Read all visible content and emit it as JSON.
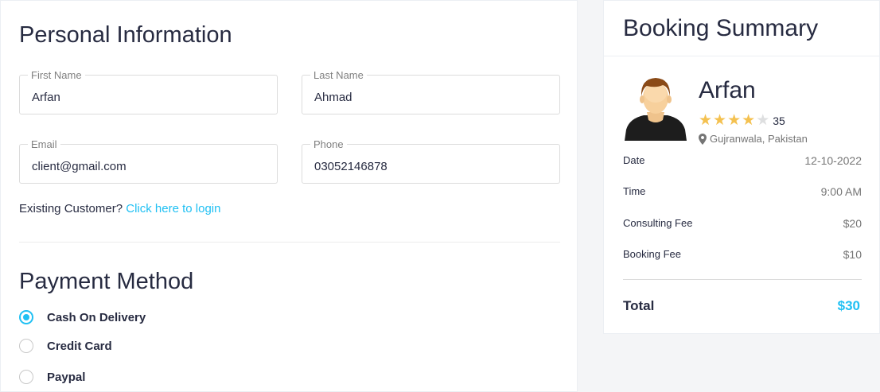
{
  "personal": {
    "title": "Personal Information",
    "first_name": {
      "label": "First Name",
      "value": "Arfan"
    },
    "last_name": {
      "label": "Last Name",
      "value": "Ahmad"
    },
    "email": {
      "label": "Email",
      "value": "client@gmail.com"
    },
    "phone": {
      "label": "Phone",
      "value": "03052146878"
    },
    "existing_text": "Existing Customer?",
    "login_link": "Click here to login"
  },
  "payment": {
    "title": "Payment Method",
    "options": [
      {
        "label": "Cash On Delivery",
        "checked": true
      },
      {
        "label": "Credit Card",
        "checked": false
      },
      {
        "label": "Paypal",
        "checked": false
      }
    ]
  },
  "summary": {
    "title": "Booking Summary",
    "doctor": {
      "name": "Arfan",
      "rating": 4,
      "rating_max": 5,
      "reviews": "35",
      "location": "Gujranwala, Pakistan"
    },
    "rows": [
      {
        "label": "Date",
        "value": "12-10-2022"
      },
      {
        "label": "Time",
        "value": "9:00 AM"
      },
      {
        "label": "Consulting Fee",
        "value": "$20"
      },
      {
        "label": "Booking Fee",
        "value": "$10"
      }
    ],
    "total_label": "Total",
    "total_value": "$30"
  },
  "colors": {
    "accent": "#20c0f3",
    "star": "#f4c150",
    "text": "#272b41"
  }
}
